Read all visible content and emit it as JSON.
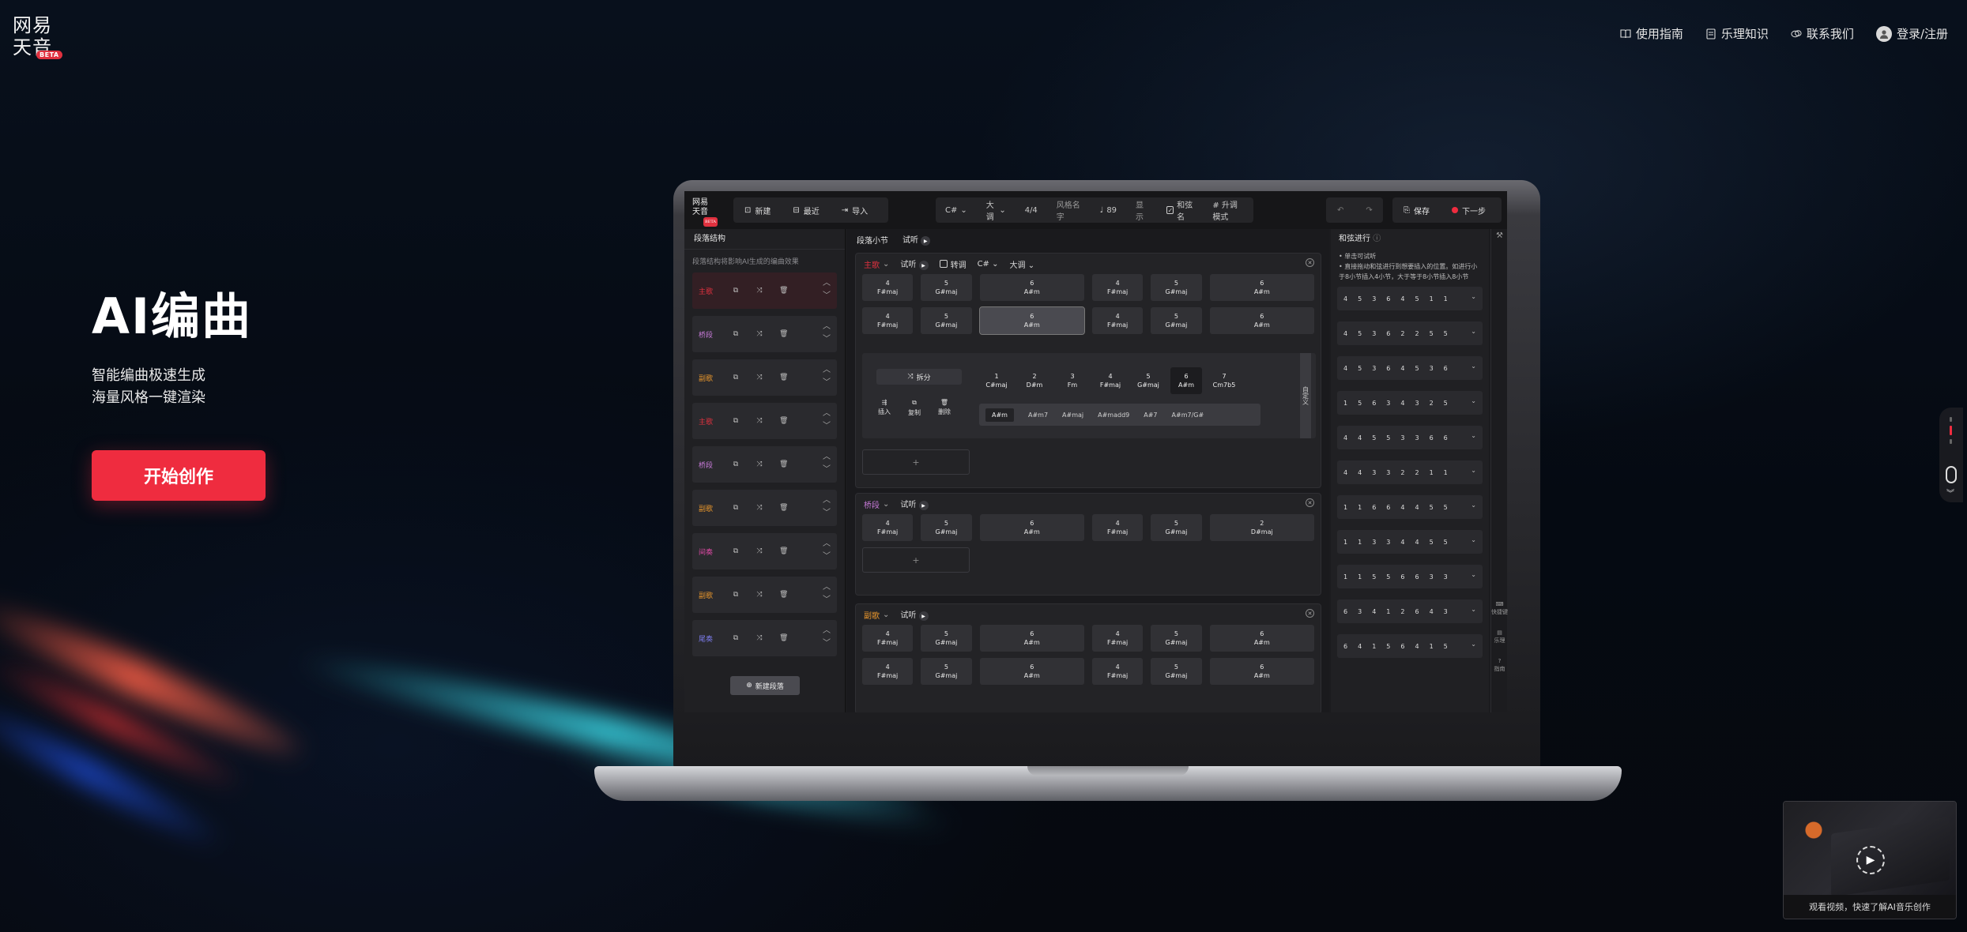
{
  "brand": {
    "logo_line1": "网易",
    "logo_line2": "天音",
    "beta": "BETA"
  },
  "nav": {
    "items": [
      {
        "label": "使用指南",
        "icon": "book-icon"
      },
      {
        "label": "乐理知识",
        "icon": "note-icon"
      },
      {
        "label": "联系我们",
        "icon": "chat-icon"
      },
      {
        "label": "登录/注册",
        "icon": "user-icon"
      }
    ]
  },
  "hero": {
    "title": "AI编曲",
    "sub1": "智能编曲极速生成",
    "sub2": "海量风格一键渲染",
    "cta": "开始创作"
  },
  "app": {
    "toolbar": {
      "new": "新建",
      "recent": "最近",
      "import": "导入",
      "key": "C#",
      "mode": "大调",
      "meter": "4/4",
      "style": "风格名字",
      "tempo": "89",
      "display": "显示",
      "chord_name": "和弦名",
      "rising": "# 升调模式",
      "save": "保存",
      "next": "下一步"
    },
    "left": {
      "title": "段落结构",
      "tip": "段落结构将影响AI生成的编曲效果",
      "segments": [
        {
          "name": "主歌",
          "color": "#e0313f"
        },
        {
          "name": "桥段",
          "color": "#c77ad8"
        },
        {
          "name": "副歌",
          "color": "#e8962c"
        },
        {
          "name": "主歌",
          "color": "#e0313f"
        },
        {
          "name": "桥段",
          "color": "#c77ad8"
        },
        {
          "name": "副歌",
          "color": "#e8962c"
        },
        {
          "name": "间奏",
          "color": "#e04aa6"
        },
        {
          "name": "副歌",
          "color": "#e8962c"
        },
        {
          "name": "尾奏",
          "color": "#7a7ae8"
        }
      ],
      "new_segment": "新建段落"
    },
    "center": {
      "title": "段落小节",
      "listen": "试听",
      "sec1": {
        "name": "主歌",
        "listen": "试听",
        "transpose": "转调",
        "key": "C#",
        "mode": "大调"
      },
      "sec2": {
        "name": "桥段",
        "listen": "试听"
      },
      "sec3": {
        "name": "副歌",
        "listen": "试听"
      },
      "row_a": [
        {
          "deg": "4",
          "chord": "F#maj"
        },
        {
          "deg": "5",
          "chord": "G#maj"
        },
        {
          "deg": "6",
          "chord": "A#m"
        },
        {
          "deg": "4",
          "chord": "F#maj"
        },
        {
          "deg": "5",
          "chord": "G#maj"
        },
        {
          "deg": "6",
          "chord": "A#m"
        }
      ],
      "row_bridge": [
        {
          "deg": "4",
          "chord": "F#maj"
        },
        {
          "deg": "5",
          "chord": "G#maj"
        },
        {
          "deg": "6",
          "chord": "A#m"
        },
        {
          "deg": "4",
          "chord": "F#maj"
        },
        {
          "deg": "5",
          "chord": "G#maj"
        },
        {
          "deg": "2",
          "chord": "D#maj"
        }
      ],
      "add": "+",
      "editor": {
        "split": "拆分",
        "insert": "插入",
        "copy": "复制",
        "delete": "删除",
        "choices": [
          {
            "deg": "1",
            "chord": "C#maj"
          },
          {
            "deg": "2",
            "chord": "D#m"
          },
          {
            "deg": "3",
            "chord": "Fm"
          },
          {
            "deg": "4",
            "chord": "F#maj"
          },
          {
            "deg": "5",
            "chord": "G#maj"
          },
          {
            "deg": "6",
            "chord": "A#m"
          },
          {
            "deg": "7",
            "chord": "Cm7b5"
          }
        ],
        "variants": [
          "A#m",
          "A#m7",
          "A#maj",
          "A#madd9",
          "A#7",
          "A#m7/G#"
        ],
        "custom": "自定义"
      }
    },
    "right": {
      "title": "和弦进行",
      "tip1": "• 单击可试听",
      "tip2": "• 直接拖动和弦进行到想要插入的位置。如进行小于8小节插入4小节，大于等于8小节插入8小节",
      "progressions": [
        [
          "4",
          "5",
          "3",
          "6",
          "4",
          "5",
          "1",
          "1"
        ],
        [
          "4",
          "5",
          "3",
          "6",
          "2",
          "2",
          "5",
          "5"
        ],
        [
          "4",
          "5",
          "3",
          "6",
          "4",
          "5",
          "3",
          "6"
        ],
        [
          "1",
          "5",
          "6",
          "3",
          "4",
          "3",
          "2",
          "5"
        ],
        [
          "4",
          "4",
          "5",
          "5",
          "3",
          "3",
          "6",
          "6"
        ],
        [
          "4",
          "4",
          "3",
          "3",
          "2",
          "2",
          "1",
          "1"
        ],
        [
          "1",
          "1",
          "6",
          "6",
          "4",
          "4",
          "5",
          "5"
        ],
        [
          "1",
          "1",
          "3",
          "3",
          "4",
          "4",
          "5",
          "5"
        ],
        [
          "1",
          "1",
          "5",
          "5",
          "6",
          "6",
          "3",
          "3"
        ],
        [
          "6",
          "3",
          "4",
          "1",
          "2",
          "6",
          "4",
          "3"
        ],
        [
          "6",
          "4",
          "1",
          "5",
          "6",
          "4",
          "1",
          "5"
        ]
      ],
      "rail": {
        "shortcut": "快捷键",
        "theory": "乐理",
        "guide": "指南"
      }
    }
  },
  "video": {
    "caption": "观看视频，快速了解AI音乐创作"
  },
  "colors": {
    "accent": "#ef2c3f"
  }
}
